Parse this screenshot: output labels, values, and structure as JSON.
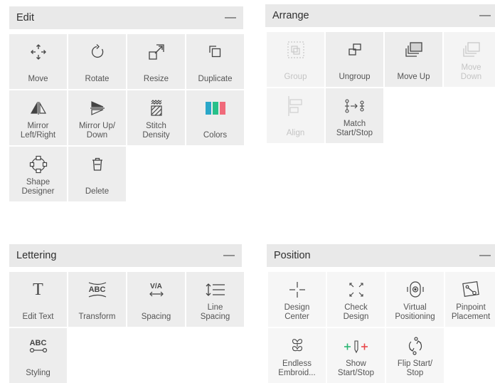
{
  "edit": {
    "title": "Edit",
    "collapse": "—",
    "tiles": [
      {
        "label": "Move",
        "icon": "move-icon"
      },
      {
        "label": "Rotate",
        "icon": "rotate-icon"
      },
      {
        "label": "Resize",
        "icon": "resize-icon"
      },
      {
        "label": "Duplicate",
        "icon": "duplicate-icon"
      },
      {
        "label": "Mirror\nLeft/Right",
        "icon": "mirror-left-right-icon"
      },
      {
        "label": "Mirror Up/\nDown",
        "icon": "mirror-up-down-icon"
      },
      {
        "label": "Stitch\nDensity",
        "icon": "stitch-density-icon"
      },
      {
        "label": "Colors",
        "icon": "colors-icon"
      },
      {
        "label": "Shape\nDesigner",
        "icon": "shape-designer-icon"
      },
      {
        "label": "Delete",
        "icon": "trash-icon"
      }
    ]
  },
  "arrange": {
    "title": "Arrange",
    "collapse": "—",
    "tiles": [
      {
        "label": "Group",
        "icon": "group-icon",
        "enabled": false
      },
      {
        "label": "Ungroup",
        "icon": "ungroup-icon",
        "enabled": true
      },
      {
        "label": "Move Up",
        "icon": "move-up-icon",
        "enabled": true
      },
      {
        "label": "Move\nDown",
        "icon": "move-down-icon",
        "enabled": false
      },
      {
        "label": "Align",
        "icon": "align-icon",
        "enabled": false
      },
      {
        "label": "Match\nStart/Stop",
        "icon": "match-start-stop-icon",
        "enabled": true
      }
    ]
  },
  "lettering": {
    "title": "Lettering",
    "collapse": "—",
    "tiles": [
      {
        "label": "Edit Text",
        "icon": "text-icon",
        "glyph": "T"
      },
      {
        "label": "Transform",
        "icon": "transform-icon",
        "glyph": "ABC"
      },
      {
        "label": "Spacing",
        "icon": "spacing-icon",
        "glyph": "V/A"
      },
      {
        "label": "Line\nSpacing",
        "icon": "line-spacing-icon"
      },
      {
        "label": "Styling",
        "icon": "styling-icon",
        "glyph": "ABC"
      }
    ]
  },
  "position": {
    "title": "Position",
    "collapse": "—",
    "tiles": [
      {
        "label": "Design\nCenter",
        "icon": "design-center-icon"
      },
      {
        "label": "Check\nDesign",
        "icon": "check-design-icon"
      },
      {
        "label": "Virtual\nPositioning",
        "icon": "virtual-positioning-icon"
      },
      {
        "label": "Pinpoint\nPlacement",
        "icon": "pinpoint-placement-icon"
      },
      {
        "label": "Endless\nEmbroid...",
        "icon": "endless-embroidery-icon"
      },
      {
        "label": "Show\nStart/Stop",
        "icon": "show-start-stop-icon"
      },
      {
        "label": "Flip Start/\nStop",
        "icon": "flip-start-stop-icon"
      }
    ]
  },
  "colors": {
    "accent_green": "#2bb673",
    "accent_red": "#e8474b",
    "swatch_teal": "#2aa7c9",
    "swatch_green": "#27c08a",
    "swatch_pink": "#f06a7a"
  }
}
